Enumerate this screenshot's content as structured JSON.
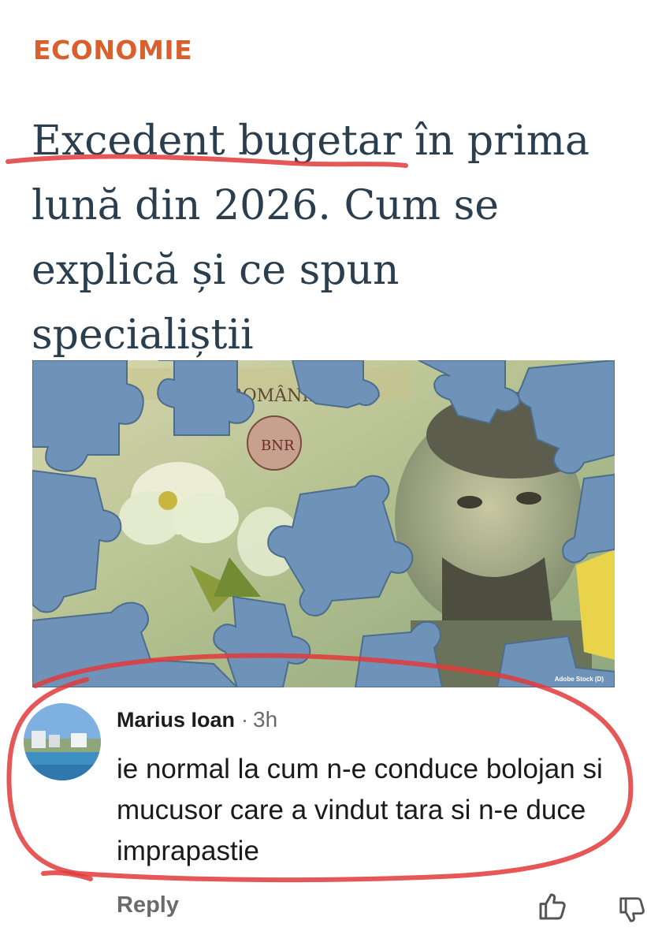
{
  "article": {
    "category": "ECONOMIE",
    "headline": "Excedent bugetar în prima lună din 2026. Cum se explică și ce spun specialiștii",
    "image": {
      "banknote_text": "ROMÂNIEI",
      "monogram": "BNR",
      "credit": "Adobe Stock (D)"
    }
  },
  "comment": {
    "author": "Marius Ioan",
    "separator": "·",
    "timestamp": "3h",
    "text": "ie normal la cum n-e conduce bolojan si mucusor care a vindut tara si n-e duce imprapastie",
    "reply_label": "Reply",
    "like_icon": "thumbs-up-icon",
    "dislike_icon": "thumbs-down-icon"
  },
  "colors": {
    "category": "#d9602c",
    "headline": "#2a3e4e",
    "annotation": "#e23a3a",
    "puzzle": "#6f93b8"
  }
}
